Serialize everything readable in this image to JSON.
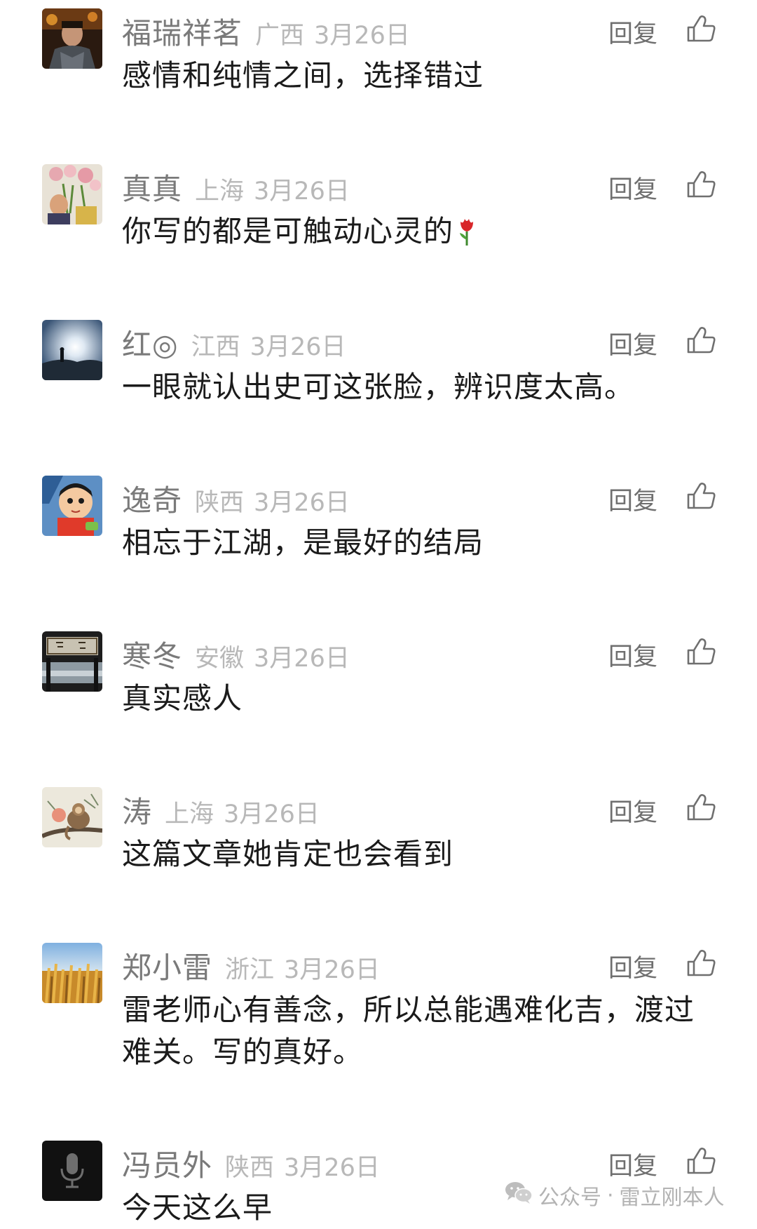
{
  "actions": {
    "reply_label": "回复"
  },
  "comments": [
    {
      "nickname": "福瑞祥茗",
      "region": "广西",
      "date": "3月26日",
      "content": "感情和纯情之间，选择错过"
    },
    {
      "nickname": "真真",
      "region": "上海",
      "date": "3月26日",
      "content": "你写的都是可触动心灵的",
      "emoji": "rose-icon"
    },
    {
      "nickname": "红◎",
      "region": "江西",
      "date": "3月26日",
      "content": "一眼就认出史可这张脸，辨识度太高。"
    },
    {
      "nickname": "逸奇",
      "region": "陕西",
      "date": "3月26日",
      "content": "相忘于江湖，是最好的结局"
    },
    {
      "nickname": "寒冬",
      "region": "安徽",
      "date": "3月26日",
      "content": "真实感人"
    },
    {
      "nickname": "涛",
      "region": "上海",
      "date": "3月26日",
      "content": "这篇文章她肯定也会看到"
    },
    {
      "nickname": "郑小雷",
      "region": "浙江",
      "date": "3月26日",
      "content_line1": "雷老师心有善念，所以总能遇难化吉，渡过",
      "content_line2": "难关。写的真好。"
    },
    {
      "nickname": "冯员外",
      "region": "陕西",
      "date": "3月26日",
      "content": "今天这么早"
    }
  ],
  "watermark": {
    "label": "公众号",
    "separator": "·",
    "account": "雷立刚本人"
  },
  "colors": {
    "nickname": "#7a7a7a",
    "meta": "#b8b8b8",
    "content": "#1b1b1b",
    "action": "#6f6f6f"
  }
}
